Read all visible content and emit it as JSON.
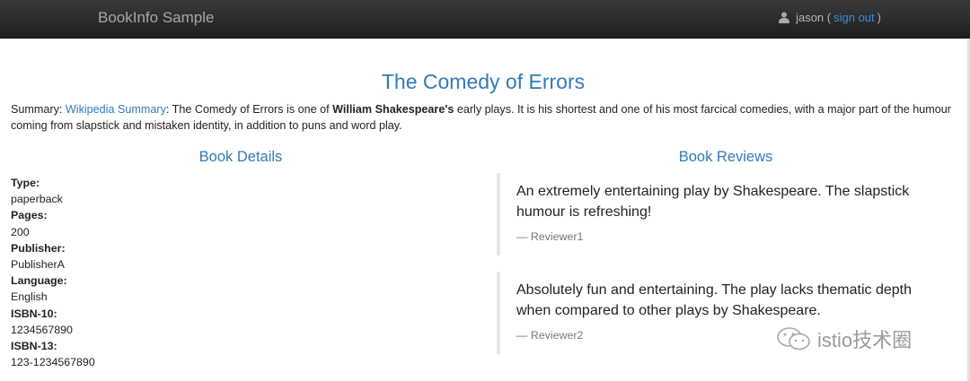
{
  "navbar": {
    "brand": "BookInfo Sample",
    "user": "jason",
    "open_paren": " (",
    "signout": "sign out",
    "close_paren": ")"
  },
  "book": {
    "title": "The Comedy of Errors",
    "summary_label": "Summary: ",
    "summary_link": "Wikipedia Summary",
    "summary_text_1": ": The Comedy of Errors is one of ",
    "summary_author": "William Shakespeare's",
    "summary_text_2": " early plays. It is his shortest and one of his most farcical comedies, with a major part of the humour coming from slapstick and mistaken identity, in addition to puns and word play."
  },
  "details": {
    "heading": "Book Details",
    "items": [
      {
        "label": "Type:",
        "value": "paperback"
      },
      {
        "label": "Pages:",
        "value": "200"
      },
      {
        "label": "Publisher:",
        "value": "PublisherA"
      },
      {
        "label": "Language:",
        "value": "English"
      },
      {
        "label": "ISBN-10:",
        "value": "1234567890"
      },
      {
        "label": "ISBN-13:",
        "value": "123-1234567890"
      }
    ]
  },
  "reviews": {
    "heading": "Book Reviews",
    "items": [
      {
        "text": "An extremely entertaining play by Shakespeare. The slapstick humour is refreshing!",
        "author": "— Reviewer1"
      },
      {
        "text": "Absolutely fun and entertaining. The play lacks thematic depth when compared to other plays by Shakespeare.",
        "author": "— Reviewer2"
      }
    ]
  },
  "watermark": {
    "text": "istio技术圈",
    "icon": "wechat-icon"
  },
  "colors": {
    "accent": "#337ab7",
    "navbar": "#2a2a2a",
    "link": "#3a8fd8"
  }
}
